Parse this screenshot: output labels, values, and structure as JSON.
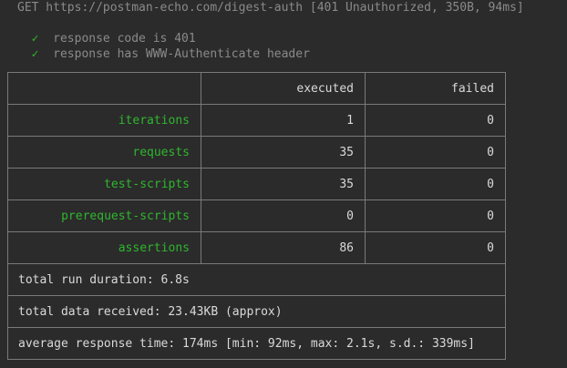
{
  "request": {
    "line": "GET https://postman-echo.com/digest-auth [401 Unauthorized, 350B, 94ms]"
  },
  "tests": [
    {
      "mark": "✓",
      "text": "response code is 401"
    },
    {
      "mark": "✓",
      "text": "response has WWW-Authenticate header"
    }
  ],
  "summary": {
    "headers": [
      "",
      "executed",
      "failed"
    ],
    "rows": [
      {
        "label": "iterations",
        "executed": "1",
        "failed": "0"
      },
      {
        "label": "requests",
        "executed": "35",
        "failed": "0"
      },
      {
        "label": "test-scripts",
        "executed": "35",
        "failed": "0"
      },
      {
        "label": "prerequest-scripts",
        "executed": "0",
        "failed": "0"
      },
      {
        "label": "assertions",
        "executed": "86",
        "failed": "0"
      }
    ],
    "duration": "total run duration: 6.8s",
    "data_received": "total data received: 23.43KB (approx)",
    "avg_response": "average response time: 174ms [min: 92ms, max: 2.1s, s.d.: 339ms]"
  },
  "colors": {
    "background": "#2b2b2b",
    "text": "#dadada",
    "dim": "#8a8a8a",
    "success": "#2fb62f",
    "border": "#7a7a7a"
  }
}
